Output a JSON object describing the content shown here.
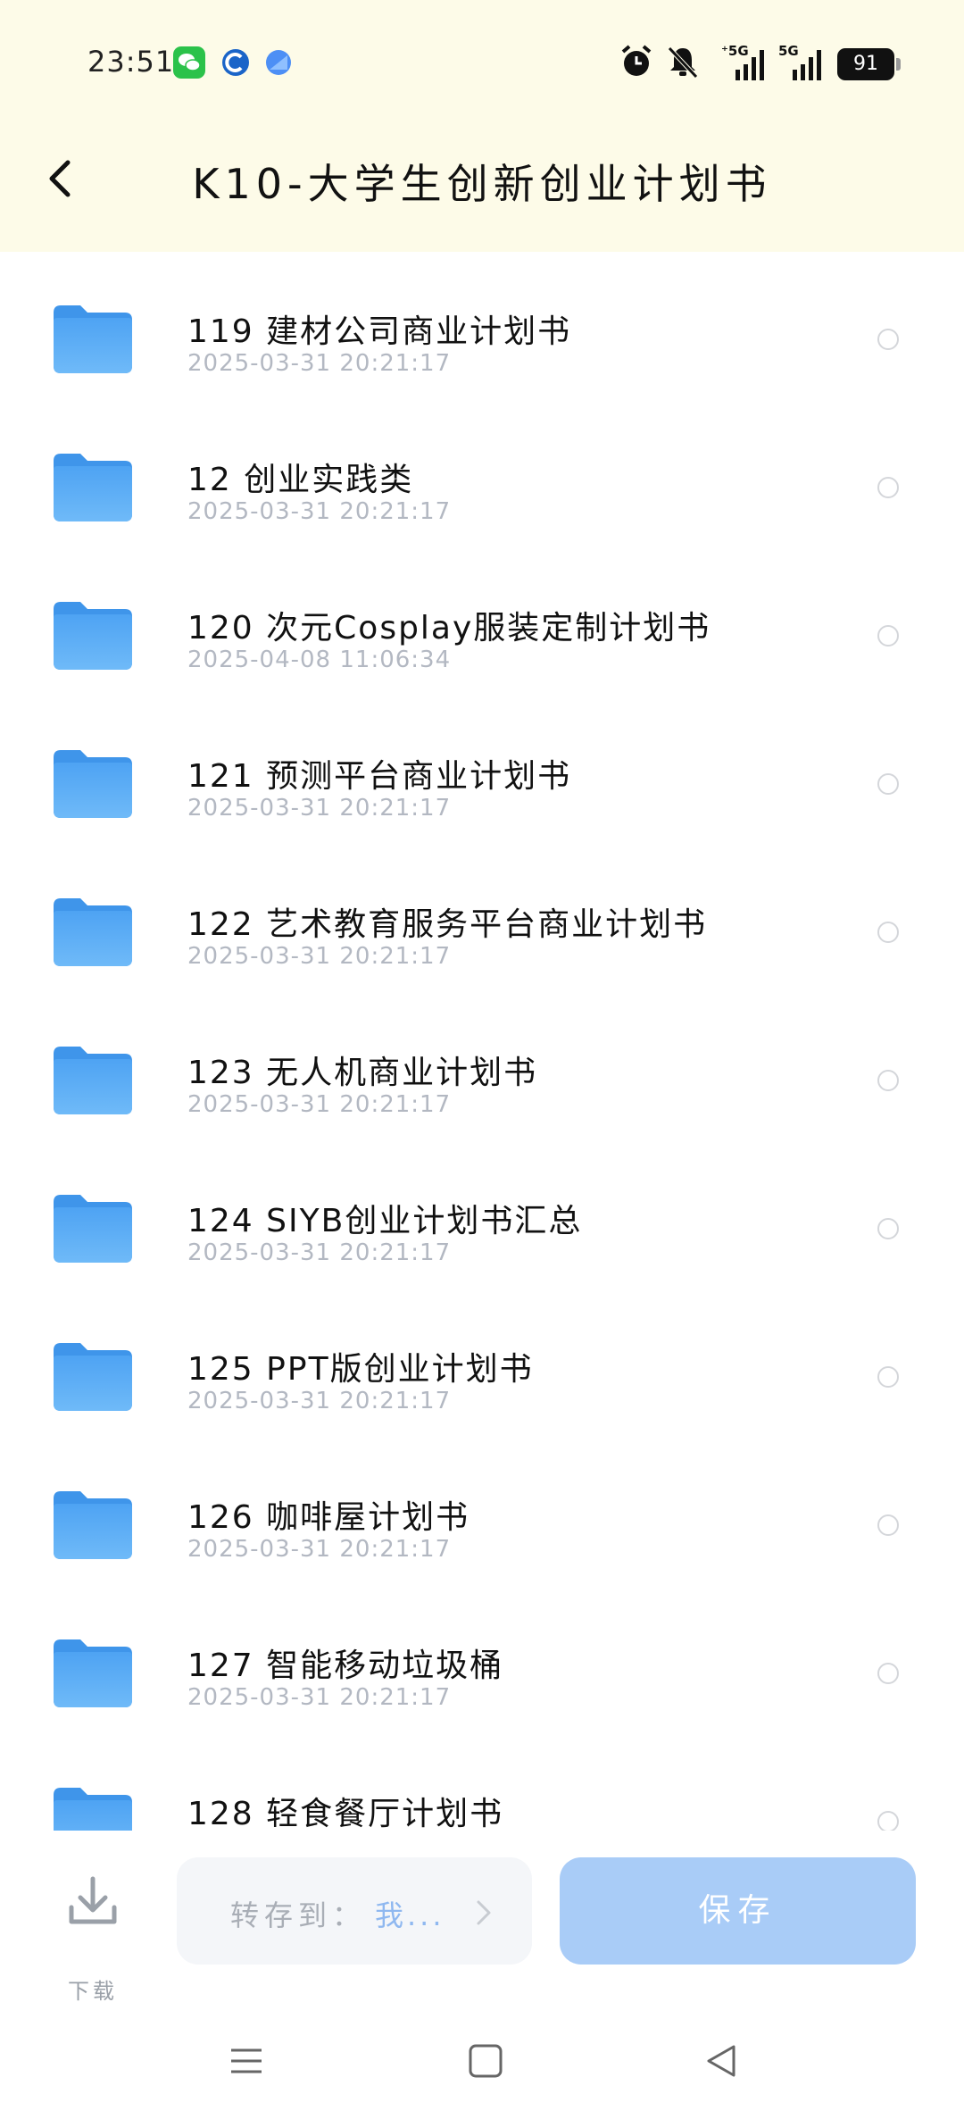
{
  "status_bar": {
    "time": "23:51",
    "icons": [
      "wechat-icon",
      "app-icon",
      "app-icon",
      "alarm-icon",
      "mute-icon",
      "5g-signal-icon",
      "5g-signal-icon"
    ],
    "battery": "91"
  },
  "header": {
    "title": "K10-大学生创新创业计划书",
    "back_icon": "chevron-left-icon"
  },
  "files": [
    {
      "name": "119 建材公司商业计划书",
      "date": "2025-03-31  20:21:17"
    },
    {
      "name": "12 创业实践类",
      "date": "2025-03-31  20:21:17"
    },
    {
      "name": "120 次元Cosplay服装定制计划书",
      "date": "2025-04-08  11:06:34"
    },
    {
      "name": "121 预测平台商业计划书",
      "date": "2025-03-31  20:21:17"
    },
    {
      "name": "122 艺术教育服务平台商业计划书",
      "date": "2025-03-31  20:21:17"
    },
    {
      "name": "123 无人机商业计划书",
      "date": "2025-03-31  20:21:17"
    },
    {
      "name": "124 SIYB创业计划书汇总",
      "date": "2025-03-31  20:21:17"
    },
    {
      "name": "125 PPT版创业计划书",
      "date": "2025-03-31  20:21:17"
    },
    {
      "name": "126 咖啡屋计划书",
      "date": "2025-03-31  20:21:17"
    },
    {
      "name": "127 智能移动垃圾桶",
      "date": "2025-03-31  20:21:17"
    },
    {
      "name": "128 轻食餐厅计划书",
      "date": ""
    }
  ],
  "bottom": {
    "download_label": "下载",
    "save_to_label": "转存到：",
    "save_to_dest": "我...",
    "save_button": "保存"
  },
  "colors": {
    "header_bg": "#fdfbe8",
    "folder": "#5aaaf5",
    "save_button": "#a9ccf7"
  }
}
